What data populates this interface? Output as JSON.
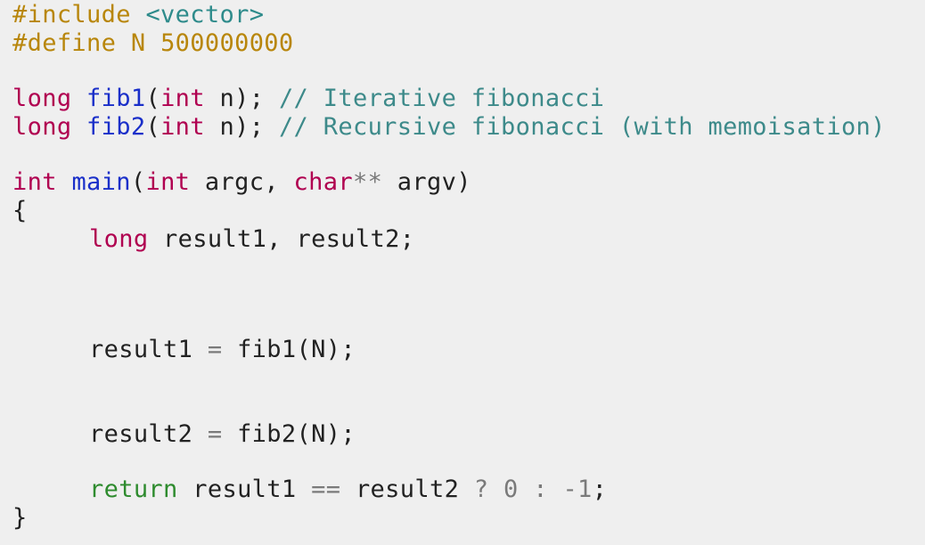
{
  "code": {
    "include_directive": "#include",
    "include_header": "<vector>",
    "define_directive": "#define N",
    "define_value": "500000000",
    "long_kw": "long",
    "int_kw": "int",
    "char_kw": "char",
    "fib1_name": "fib1",
    "fib2_name": "fib2",
    "main_name": "main",
    "fib1_comment": "// Iterative fibonacci",
    "fib2_comment": "// Recursive fibonacci (with memoisation)",
    "param_n": "n);",
    "open_paren": "(",
    "main_args_1": "argc,",
    "stars": "**",
    "main_args_2": "argv)",
    "open_brace": "{",
    "close_brace": "}",
    "decl_vars": "result1, result2;",
    "result1_assign_lhs": "result1",
    "result2_assign_lhs": "result2",
    "eq_op": "=",
    "fib1_call": "fib1(N);",
    "fib2_call": "fib2(N);",
    "return_kw": "return",
    "ret_lhs": "result1",
    "ret_eqeq": "==",
    "ret_rhs": "result2",
    "ret_q": "?",
    "ret_zero": "0",
    "ret_colon": ":",
    "ret_neg": "-1",
    "ret_semi": ";"
  },
  "colors": {
    "background": "#efefef",
    "preprocessor": "#b8860b",
    "keyword": "#b00050",
    "function": "#1a2fc9",
    "comment": "#3d8a8a",
    "return_keyword": "#2e8b2e"
  }
}
